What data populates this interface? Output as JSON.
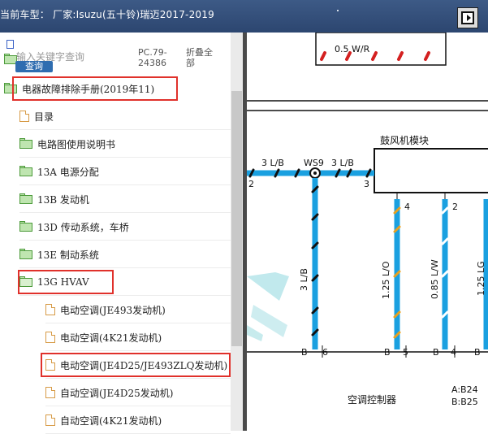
{
  "window": {
    "title": "当前车型：  厂家:Isuzu(五十铃)瑞迈2017-2019",
    "corner_button_icon": "panel-toggle-icon"
  },
  "sidebar": {
    "search_placeholder": "输入关键字查询",
    "search_button": "查询",
    "pc_code": "PC.79-24386",
    "fold_all": "折叠全部",
    "tree": [
      {
        "label": "电器故障排除手册(2019年11)",
        "type": "folder",
        "level": 0,
        "highlighted": true
      },
      {
        "label": "目录",
        "type": "doc",
        "level": 1,
        "highlighted": false
      },
      {
        "label": "电路图使用说明书",
        "type": "folder",
        "level": 1,
        "highlighted": false
      },
      {
        "label": "13A 电源分配",
        "type": "folder",
        "level": 1,
        "highlighted": false
      },
      {
        "label": "13B 发动机",
        "type": "folder",
        "level": 1,
        "highlighted": false
      },
      {
        "label": "13D 传动系统，车桥",
        "type": "folder",
        "level": 1,
        "highlighted": false
      },
      {
        "label": "13E 制动系统",
        "type": "folder",
        "level": 1,
        "highlighted": false
      },
      {
        "label": "13G HVAV",
        "type": "folder-open",
        "level": 1,
        "highlighted": true
      },
      {
        "label": "电动空调(JE493发动机)",
        "type": "doc",
        "level": 2,
        "highlighted": false
      },
      {
        "label": "电动空调(4K21发动机)",
        "type": "doc",
        "level": 2,
        "highlighted": false
      },
      {
        "label": "电动空调(JE4D25/JE493ZLQ发动机)",
        "type": "doc",
        "level": 2,
        "highlighted": true
      },
      {
        "label": "自动空调(JE4D25发动机)",
        "type": "doc",
        "level": 2,
        "highlighted": false
      },
      {
        "label": "自动空调(4K21发动机)",
        "type": "doc",
        "level": 2,
        "highlighted": false
      }
    ]
  },
  "diagram": {
    "wire_top": "0.5 W/R",
    "module_label": "鼓风机模块",
    "wire_a": "3 L/B",
    "splice": "WS9",
    "wire_b": "3 L/B",
    "pin_left": "2",
    "pin_module_3": "3",
    "pin_module_4": "4",
    "pin_module_2": "2",
    "vertical_wire_1": "3 L/B",
    "vertical_wire_2": "1.25 L/O",
    "vertical_wire_3": "0.85 L/W",
    "vertical_wire_4": "1.25 LG",
    "conn_b1": "B",
    "conn_6": "6",
    "conn_b2": "B",
    "conn_5": "5",
    "conn_b3": "B",
    "conn_4": "4",
    "conn_b4": "B",
    "controller_label": "空调控制器",
    "ref_a": "A:B24",
    "ref_b": "B:B25",
    "colors": {
      "wire_blue": "#1aa0e0",
      "dash_black": "#111111",
      "dash_orange": "#e8a020",
      "dash_red": "#d42020"
    }
  }
}
